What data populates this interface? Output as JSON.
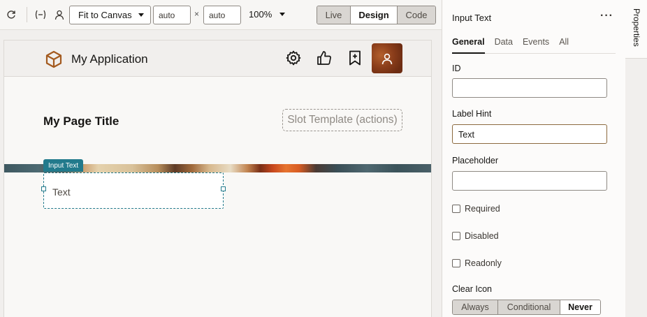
{
  "toolbar": {
    "refresh_icon": "refresh-icon",
    "bind_icon": "variable-bind-icon",
    "person_icon": "person-icon",
    "fit_option": "Fit to Canvas",
    "width_value": "auto",
    "height_value": "auto",
    "times_symbol": "×",
    "zoom": "100%",
    "modes": {
      "live": "Live",
      "design": "Design",
      "code": "Code"
    },
    "active_mode": "Design"
  },
  "canvas": {
    "app_title": "My Application",
    "header_icons": [
      "gear-icon",
      "thumbs-up-icon",
      "bookmark-add-icon",
      "user-avatar-icon"
    ],
    "page_title": "My Page Title",
    "slot_template": "Slot Template (actions)",
    "component_tag": "Input Text",
    "component_value": "Text"
  },
  "panel": {
    "title": "Input Text",
    "more": "···",
    "tabs": [
      {
        "label": "General",
        "active": true
      },
      {
        "label": "Data",
        "active": false
      },
      {
        "label": "Events",
        "active": false
      },
      {
        "label": "All",
        "active": false
      }
    ],
    "fields": {
      "id_label": "ID",
      "id_value": "",
      "label_hint_label": "Label Hint",
      "label_hint_value": "Text",
      "placeholder_label": "Placeholder",
      "placeholder_value": ""
    },
    "checkboxes": {
      "required": "Required",
      "disabled": "Disabled",
      "readonly": "Readonly"
    },
    "clear_icon": {
      "label": "Clear Icon",
      "options": {
        "always": "Always",
        "conditional": "Conditional",
        "never": "Never"
      },
      "selected": "Never"
    }
  },
  "side_tab": {
    "label": "Properties"
  },
  "colors": {
    "accent": "#227a8c",
    "focus_border": "#8c6a3f",
    "avatar": "#8a3d1a"
  }
}
